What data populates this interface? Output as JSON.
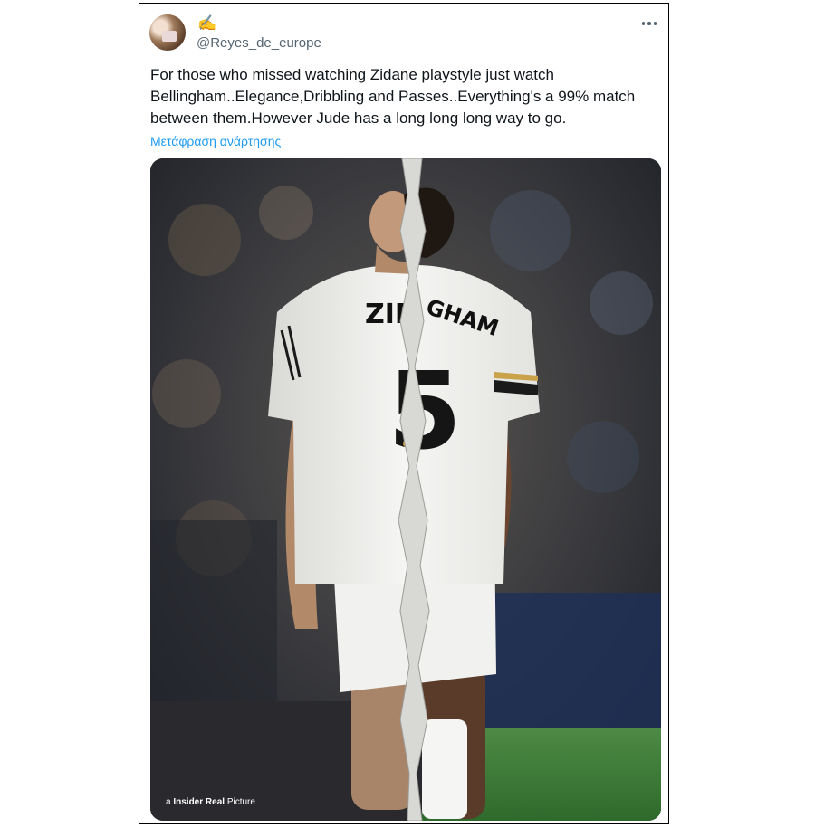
{
  "tweet": {
    "display_name_emoji": "✍️",
    "handle": "@Reyes_de_europe",
    "text": "For those who missed watching Zidane playstyle just watch Bellingham..Elegance,Dribbling and Passes..Everything's a 99% match between them.However Jude has a long long long way to go.",
    "translate_label": "Μετάφραση ανάρτησης",
    "more_icon": "more-horizontal-icon"
  },
  "media": {
    "jersey_left_name": "ZID",
    "jersey_right_name": "GHAM",
    "jersey_number": "5",
    "watermark_prefix": "a",
    "watermark_brand": "Insider Real",
    "watermark_suffix": "Picture",
    "colors": {
      "crowd_dark": "#2b2d33",
      "pitch_green": "#3f7a3a",
      "kit_white": "#f2f2f0",
      "kit_trim_black": "#1a1a1a",
      "kit_trim_gold": "#c9a24a"
    }
  }
}
